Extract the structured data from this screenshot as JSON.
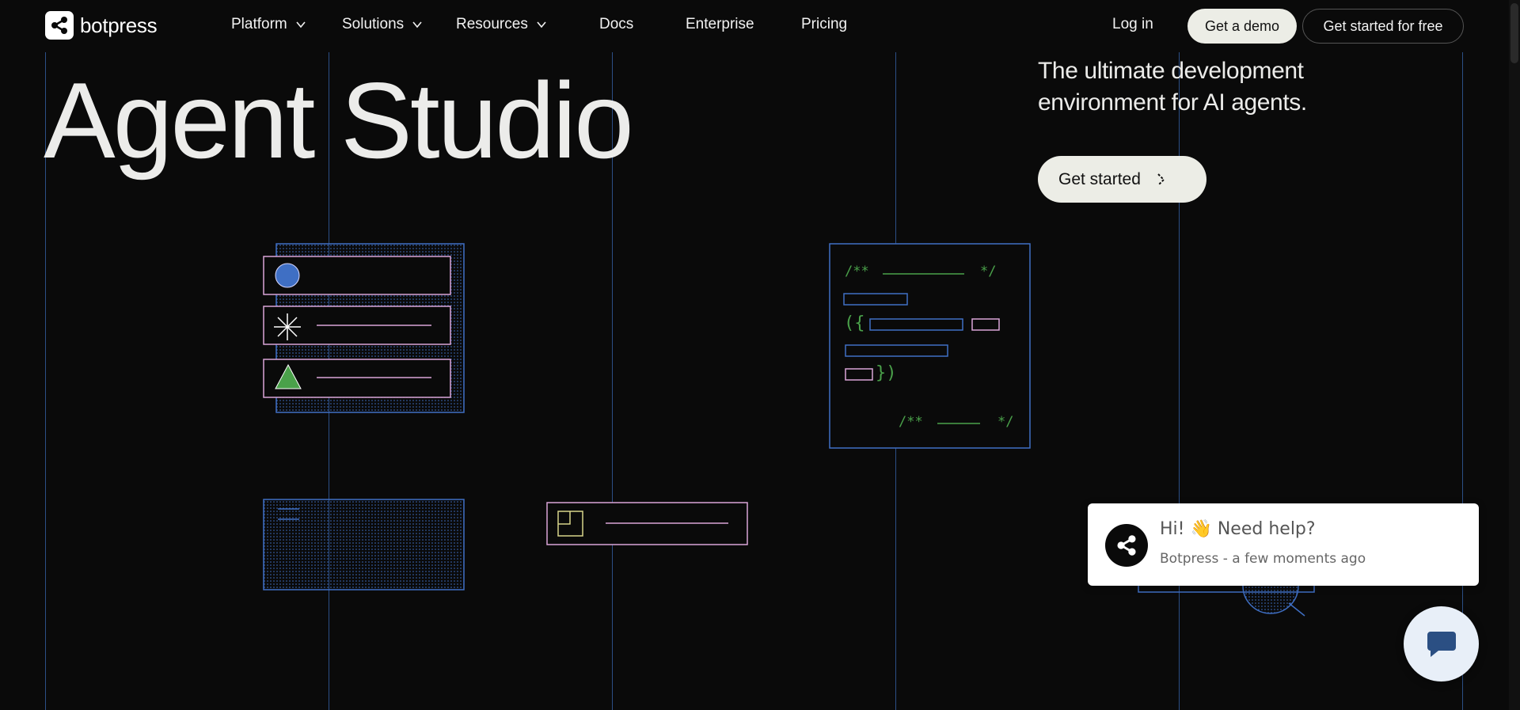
{
  "nav": {
    "logo_text": "botpress",
    "items": [
      {
        "label": "Platform",
        "has_dropdown": true
      },
      {
        "label": "Solutions",
        "has_dropdown": true
      },
      {
        "label": "Resources",
        "has_dropdown": true
      },
      {
        "label": "Docs",
        "has_dropdown": false
      },
      {
        "label": "Enterprise",
        "has_dropdown": false
      },
      {
        "label": "Pricing",
        "has_dropdown": false
      }
    ],
    "login_label": "Log in",
    "demo_label": "Get a demo",
    "free_label": "Get started for free"
  },
  "hero": {
    "title": "Agent Studio",
    "tagline_line1": "The ultimate development",
    "tagline_line2": "environment for AI agents.",
    "cta_label": "Get started"
  },
  "code_card": {
    "comment_open": "/**",
    "comment_close": "*/",
    "paren_open": "({",
    "paren_close": "})"
  },
  "chat": {
    "message": "Hi! 👋 Need help?",
    "meta": "Botpress - a few moments ago"
  },
  "colors": {
    "background": "#0a0a0a",
    "grid_line": "#2c4f86",
    "accent_blue": "#3f6fc4",
    "accent_pink": "#d9a4d8",
    "accent_green": "#4aa14a",
    "accent_yellow": "#d8d48a",
    "button_light": "#ecede6"
  }
}
